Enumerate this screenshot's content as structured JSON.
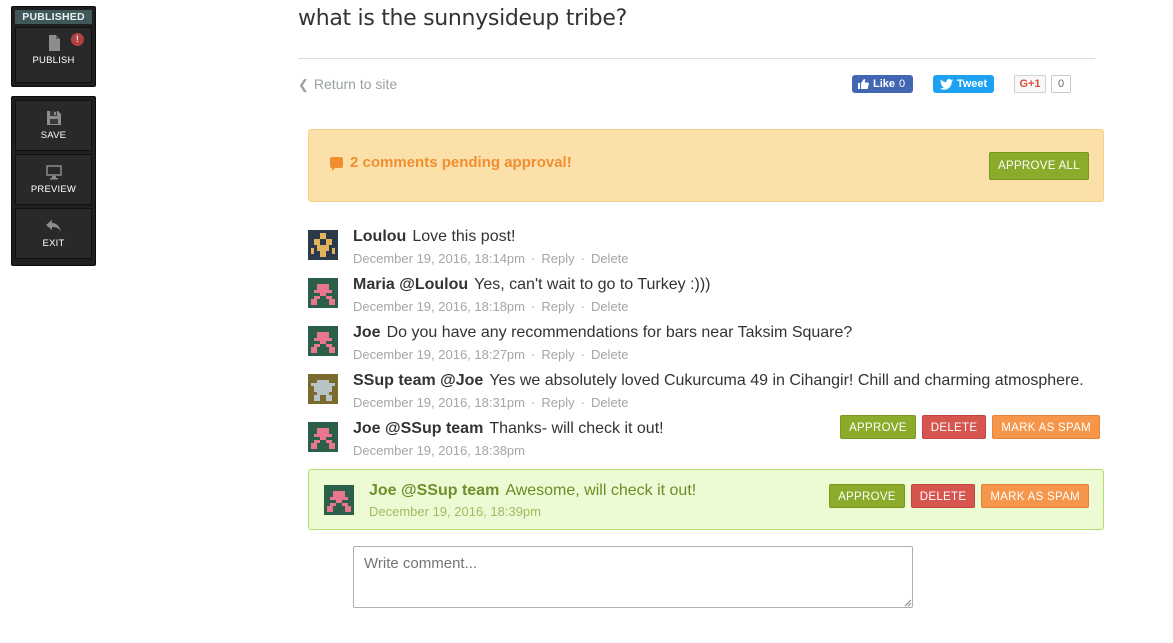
{
  "toolbar": {
    "status_badge": "PUBLISHED",
    "publish_label": "PUBLISH",
    "publish_alert": "!",
    "save_label": "SAVE",
    "preview_label": "PREVIEW",
    "exit_label": "EXIT"
  },
  "post": {
    "title": "what is the sunnysideup tribe?",
    "return_link": "Return to site"
  },
  "share": {
    "like_label": "Like",
    "like_count": "0",
    "tweet_label": "Tweet",
    "gplus_label": "G+1",
    "gplus_count": "0"
  },
  "pending": {
    "message": "2 comments pending approval!",
    "approve_all": "APPROVE ALL"
  },
  "actions": {
    "reply": "Reply",
    "delete": "Delete",
    "approve": "APPROVE",
    "delete_btn": "DELETE",
    "mark_spam": "MARK AS SPAM"
  },
  "comments": [
    {
      "author": "Loulou",
      "body": "Love this post!",
      "time": "December 19, 2016, 18:14pm"
    },
    {
      "author": "Maria @Loulou",
      "body": "Yes, can't wait to go to Turkey :)))",
      "time": "December 19, 2016, 18:18pm"
    },
    {
      "author": "Joe",
      "body": "Do you have any recommendations for bars near Taksim Square?",
      "time": "December 19, 2016, 18:27pm"
    },
    {
      "author": "SSup team @Joe",
      "body": "Yes we absolutely loved Cukurcuma 49 in Cihangir! Chill and charming atmosphere.",
      "time": "December 19, 2016, 18:31pm"
    },
    {
      "author": "Joe @SSup team",
      "body": "Thanks- will check it out!",
      "time": "December 19, 2016, 18:38pm"
    },
    {
      "author": "Joe @SSup team",
      "body": "Awesome, will check it out!",
      "time": "December 19, 2016, 18:39pm"
    }
  ],
  "composer": {
    "placeholder": "Write comment..."
  },
  "colors": {
    "approve": "#8aac2a",
    "delete": "#d6554f",
    "spam": "#f5964a",
    "pending_bg": "#fbe0a9",
    "pending_text": "#f08f32",
    "highlight_bg": "#ecfbd3"
  }
}
